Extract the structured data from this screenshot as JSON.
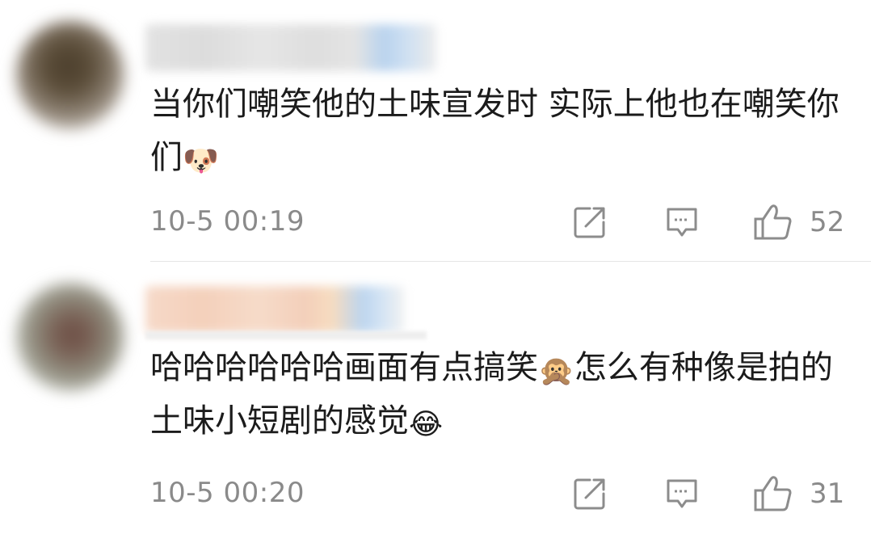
{
  "comments": [
    {
      "text": "当你们嘲笑他的土味宣发时 实际上他也在嘲笑你们",
      "emoji": "🐶",
      "timestamp": "10-5 00:19",
      "likes": "52"
    },
    {
      "text": "哈哈哈哈哈哈画面有点搞笑",
      "emoji_mid": "🙊",
      "text_after": "怎么有种像是拍的土味小短剧的感觉",
      "emoji": "😂",
      "timestamp": "10-5 00:20",
      "likes": "31"
    }
  ],
  "icons": {
    "share": "share-icon",
    "reply": "comment-icon",
    "like": "thumbs-up-icon"
  },
  "colors": {
    "text": "#1b1b1b",
    "meta": "#8a8a8a",
    "icon": "#8c8c8c",
    "divider": "#e6e6e6"
  }
}
